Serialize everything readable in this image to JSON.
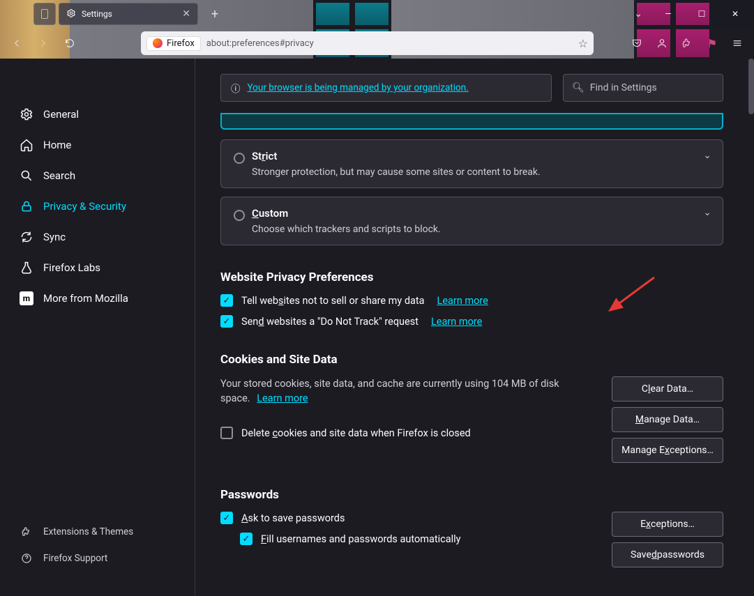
{
  "window": {
    "tab_title": "Settings",
    "new_tab_tooltip": "+",
    "min": "—",
    "max": "☐",
    "close": "✕"
  },
  "toolbar": {
    "identity_label": "Firefox",
    "url": "about:preferences#privacy"
  },
  "sidebar": {
    "items": [
      {
        "label": "General"
      },
      {
        "label": "Home"
      },
      {
        "label": "Search"
      },
      {
        "label": "Privacy & Security"
      },
      {
        "label": "Sync"
      },
      {
        "label": "Firefox Labs"
      },
      {
        "label": "More from Mozilla"
      }
    ],
    "bottom": [
      {
        "label": "Extensions & Themes"
      },
      {
        "label": "Firefox Support"
      }
    ]
  },
  "content": {
    "org_notice": "Your browser is being managed by your organization.",
    "search_placeholder": "Find in Settings",
    "cards": {
      "strict": {
        "title_pre": "St",
        "title_u": "r",
        "title_post": "ict",
        "desc": "Stronger protection, but may cause some sites or content to break."
      },
      "custom": {
        "title_u": "C",
        "title_post": "ustom",
        "desc": "Choose which trackers and scripts to block."
      }
    },
    "sections": {
      "privacy_prefs": {
        "title": "Website Privacy Preferences",
        "opt1_pre": "Tell web",
        "opt1_u": "s",
        "opt1_post": "ites not to sell or share my data",
        "opt2_pre": "Sen",
        "opt2_u": "d",
        "opt2_post": " websites a \"Do Not Track\" request",
        "learn_more": "Learn more"
      },
      "cookies": {
        "title": "Cookies and Site Data",
        "desc_pre": "Your stored cookies, site data, and cache are currently using ",
        "desc_size": "104 MB",
        "desc_post": " of disk space. ",
        "learn_more": "Learn more",
        "delete_pre": "Delete ",
        "delete_u": "c",
        "delete_post": "ookies and site data when Firefox is closed",
        "btn_clear_pre": "C",
        "btn_clear_u": "l",
        "btn_clear_post": "ear Data…",
        "btn_manage_u": "M",
        "btn_manage_post": "anage Data…",
        "btn_exc_pre": "Manage E",
        "btn_exc_u": "x",
        "btn_exc_post": "ceptions…"
      },
      "passwords": {
        "title": "Passwords",
        "ask_u": "A",
        "ask_post": "sk to save passwords",
        "fill_u": "F",
        "fill_post": "ill usernames and passwords automatically",
        "btn_exc_pre": "E",
        "btn_exc_u": "x",
        "btn_exc_post": "ceptions…",
        "btn_saved_pre": "Save",
        "btn_saved_u": "d",
        "btn_saved_post": " passwords"
      }
    }
  }
}
